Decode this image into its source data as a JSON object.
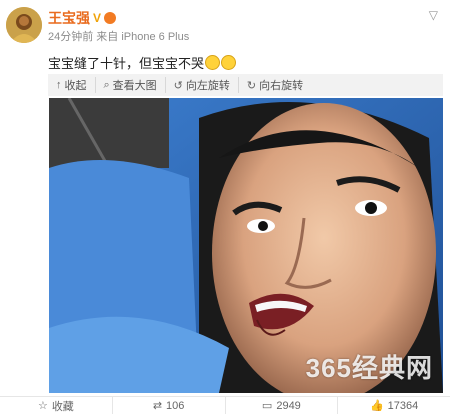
{
  "post": {
    "username": "王宝强",
    "verified_badge": "V",
    "meta": "24分钟前 来自 iPhone 6 Plus",
    "text": "宝宝缝了十针，但宝宝不哭",
    "emoji_icons": [
      "crying-face-icon",
      "crying-face-icon"
    ]
  },
  "toolbar": {
    "collapse": "收起",
    "view_large": "查看大图",
    "rotate_left": "向左旋转",
    "rotate_right": "向右旋转"
  },
  "watermark": "365经典网",
  "footer": {
    "favorite": "收藏",
    "repost": "106",
    "comment": "2949",
    "like": "17364"
  },
  "colors": {
    "username": "#e96b1e",
    "toolbar_bg": "#f2f2f2",
    "sheet_blue": "#2a5ea6"
  }
}
